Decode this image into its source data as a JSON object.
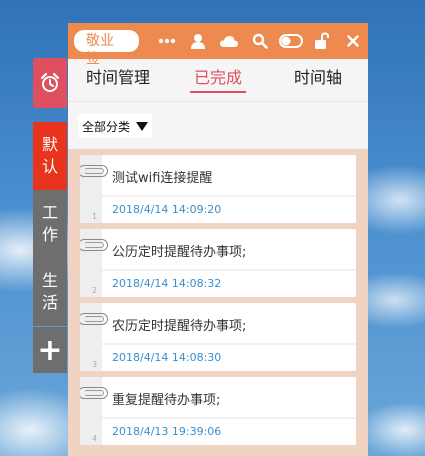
{
  "window": {
    "brand": "敬业签"
  },
  "toolbar": {
    "icons": [
      "more-icon",
      "user-icon",
      "cloud-icon",
      "search-icon",
      "toggle-icon",
      "unlock-icon",
      "close-icon"
    ]
  },
  "sidebar": {
    "categories": [
      {
        "label_line1": "默",
        "label_line2": "认",
        "active": true,
        "color": "#e8341c"
      },
      {
        "label_line1": "工",
        "label_line2": "作",
        "active": false,
        "color": "#6e6e6e"
      },
      {
        "label_line1": "生",
        "label_line2": "活",
        "active": false,
        "color": "#6e6e6e"
      }
    ],
    "add_label": "+"
  },
  "tabs": [
    {
      "label": "时间管理",
      "active": false
    },
    {
      "label": "已完成",
      "active": true
    },
    {
      "label": "时间轴",
      "active": false
    }
  ],
  "filter": {
    "selected": "全部分类"
  },
  "items": [
    {
      "num": "1",
      "title": "测试wifi连接提醒",
      "time": "2018/4/14 14:09:20"
    },
    {
      "num": "2",
      "title": "公历定时提醒待办事项;",
      "time": "2018/4/14 14:08:32"
    },
    {
      "num": "3",
      "title": "农历定时提醒待办事项;",
      "time": "2018/4/14 14:08:30"
    },
    {
      "num": "4",
      "title": "重复提醒待办事项;",
      "time": "2018/4/13 19:39:06"
    }
  ],
  "colors": {
    "accent": "#ee8a4f",
    "active_tab": "#e04f5f",
    "time_text": "#3a8fd0",
    "alarm_tab": "#e04f5f"
  }
}
